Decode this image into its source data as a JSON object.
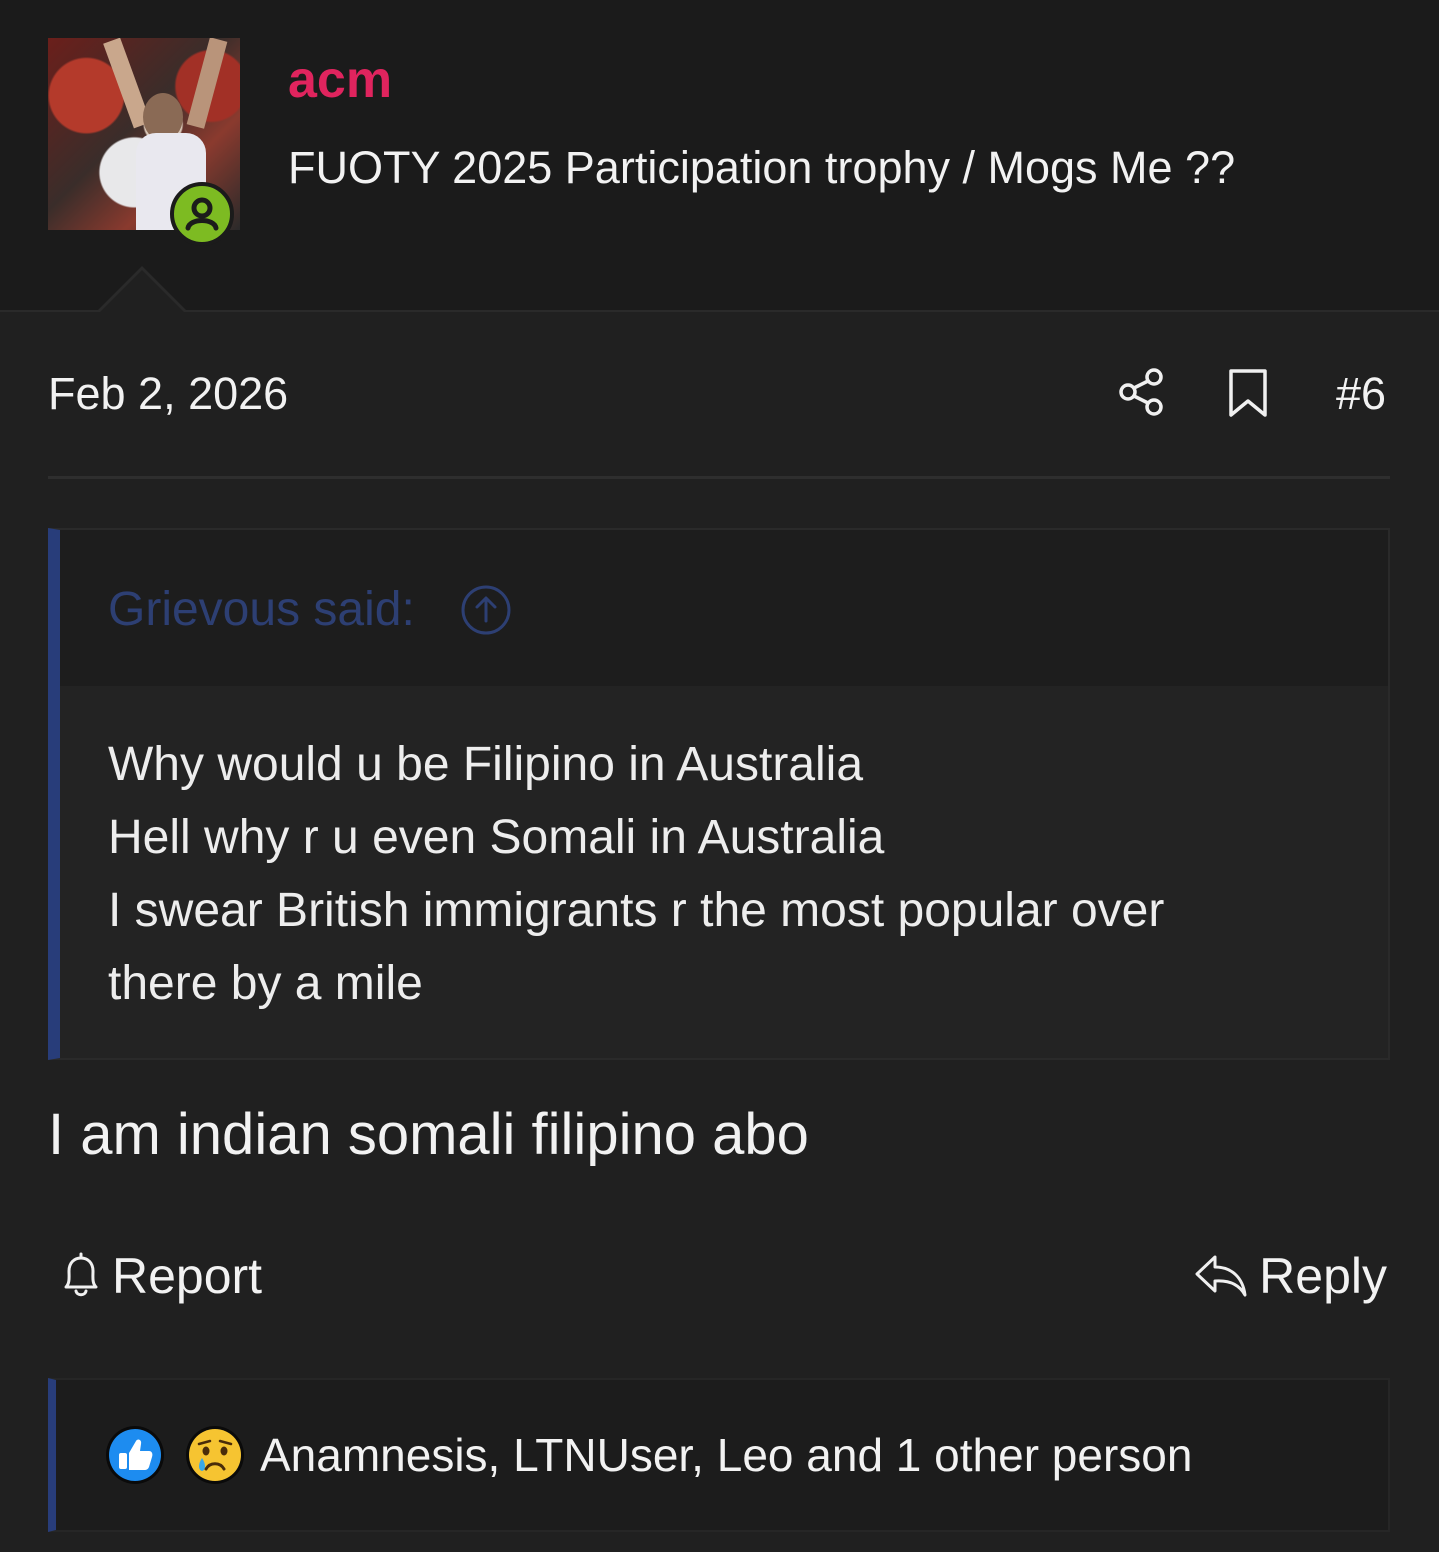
{
  "user": {
    "name": "acm",
    "title": "FUOTY 2025 Participation trophy / Mogs Me ??",
    "online_status": "online"
  },
  "post": {
    "date": "Feb 2, 2026",
    "number": "#6",
    "message": "I am indian somali filipino abo"
  },
  "quote": {
    "author": "Grievous said:",
    "lines": [
      "Why would u be Filipino in Australia",
      "Hell why r u even Somali in Australia",
      "I swear British immigrants r the most popular over",
      "there by a mile"
    ]
  },
  "actions": {
    "report_label": "Report",
    "reply_label": "Reply"
  },
  "reactions": {
    "icons": [
      "like-icon",
      "sad-icon"
    ],
    "summary": "Anamnesis, LTNUser, Leo and 1 other person"
  },
  "colors": {
    "background": "#202020",
    "username": "#e0245e",
    "quote_accent": "#283d7a",
    "online": "#7dbb22"
  }
}
